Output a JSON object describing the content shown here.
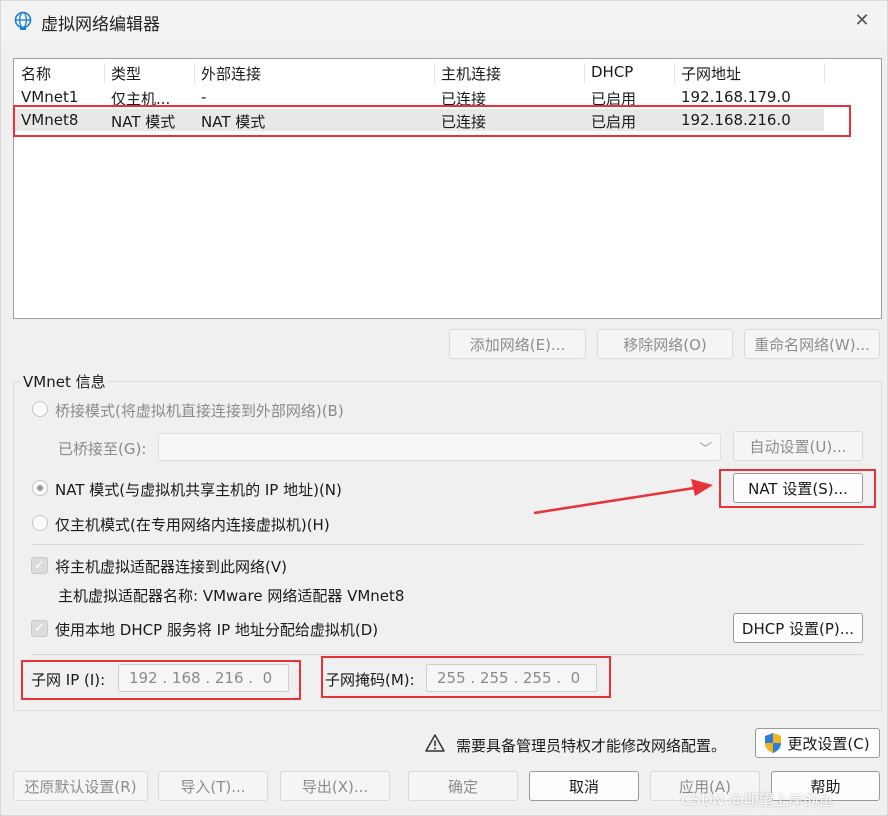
{
  "window": {
    "title": "虚拟网络编辑器",
    "close_glyph": "✕"
  },
  "table": {
    "headers": [
      "名称",
      "类型",
      "外部连接",
      "主机连接",
      "DHCP",
      "子网地址"
    ],
    "rows": [
      [
        "VMnet1",
        "仅主机...",
        "-",
        "已连接",
        "已启用",
        "192.168.179.0"
      ],
      [
        "VMnet8",
        "NAT 模式",
        "NAT 模式",
        "已连接",
        "已启用",
        "192.168.216.0"
      ]
    ]
  },
  "list_buttons": {
    "add": "添加网络(E)...",
    "remove": "移除网络(O)",
    "rename": "重命名网络(W)..."
  },
  "vmnet_info": {
    "title": "VMnet 信息",
    "bridge_mode": "桥接模式(将虚拟机直接连接到外部网络)(B)",
    "bridged_to": "已桥接至(G):",
    "auto_settings": "自动设置(U)...",
    "nat_mode": "NAT 模式(与虚拟机共享主机的 IP 地址)(N)",
    "nat_settings": "NAT 设置(S)...",
    "host_only_mode": "仅主机模式(在专用网络内连接虚拟机)(H)",
    "connect_adapter": "将主机虚拟适配器连接到此网络(V)",
    "adapter_name": "主机虚拟适配器名称: VMware 网络适配器 VMnet8",
    "use_dhcp": "使用本地 DHCP 服务将 IP 地址分配给虚拟机(D)",
    "dhcp_settings": "DHCP 设置(P)...",
    "subnet_ip_label": "子网 IP (I):",
    "subnet_ip_value": "192 . 168 . 216 .  0",
    "subnet_mask_label": "子网掩码(M):",
    "subnet_mask_value": "255 . 255 . 255 .  0",
    "check_glyph": "✓"
  },
  "admin": {
    "notice": "需要具备管理员特权才能修改网络配置。",
    "change_settings": "更改设置(C)"
  },
  "footer": {
    "restore": "还原默认设置(R)",
    "import": "导入(T)...",
    "export": "导出(X)...",
    "ok": "确定",
    "cancel": "取消",
    "apply": "应用(A)",
    "help": "帮助"
  },
  "watermark": "CSDN @期望上岸的鱼",
  "colors": {
    "highlight": "#e8323a",
    "window_bg": "#f0f0f0"
  }
}
